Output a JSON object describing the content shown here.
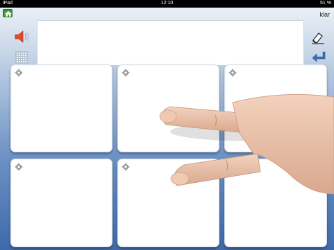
{
  "status_bar": {
    "device": "iPad",
    "time": "12:10",
    "battery": "51 %"
  },
  "toolbar": {
    "done_label": "klar",
    "home_icon": "home-icon",
    "speaker_icon": "speaker-icon",
    "keyboard_grid_icon": "grid-icon",
    "clear_icon": "eraser-icon",
    "enter_icon": "enter-icon"
  },
  "message_field": {
    "value": ""
  },
  "tiles": [
    {
      "label": "",
      "icon": "gear-icon"
    },
    {
      "label": "",
      "icon": "gear-icon"
    },
    {
      "label": "",
      "icon": "gear-icon"
    },
    {
      "label": "",
      "icon": "gear-icon"
    },
    {
      "label": "",
      "icon": "gear-icon"
    },
    {
      "label": "",
      "icon": "gear-icon"
    }
  ],
  "colors": {
    "background_top": "#eaf0f7",
    "background_bottom": "#3e6aab",
    "home_green": "#3a9d3a",
    "speaker_red": "#e24a2e",
    "enter_blue": "#3d6fb3"
  }
}
